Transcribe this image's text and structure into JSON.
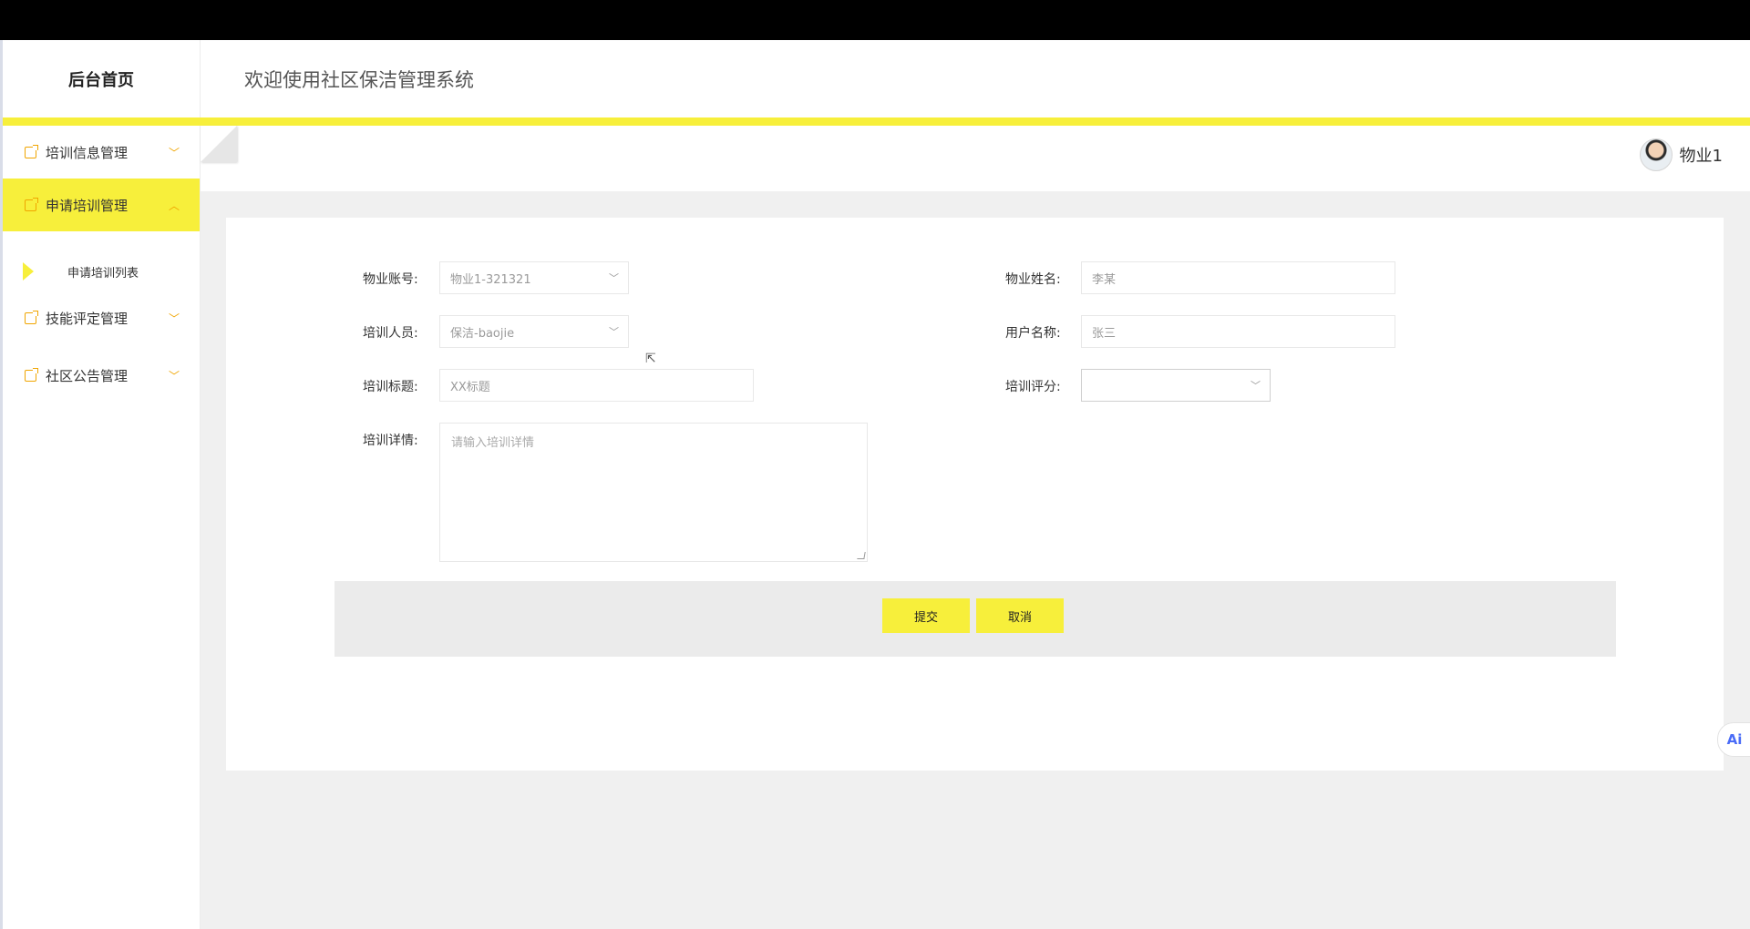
{
  "brand": {
    "title": "后台首页"
  },
  "header": {
    "welcome": "欢迎使用社区保洁管理系统"
  },
  "sidebar": {
    "items": [
      {
        "label": "培训信息管理",
        "icon": "folder-icon",
        "expanded": false
      },
      {
        "label": "申请培训管理",
        "icon": "folder-icon",
        "expanded": true
      },
      {
        "label": "技能评定管理",
        "icon": "folder-icon",
        "expanded": false
      },
      {
        "label": "社区公告管理",
        "icon": "folder-icon",
        "expanded": false
      }
    ],
    "sub_item": {
      "label": "申请培训列表"
    }
  },
  "user": {
    "name": "物业1",
    "avatar": "avatar-icon"
  },
  "form": {
    "account": {
      "label": "物业账号:",
      "value": "物业1-321321"
    },
    "owner_name": {
      "label": "物业姓名:",
      "value": "李某"
    },
    "trainee": {
      "label": "培训人员:",
      "value": "保洁-baojie"
    },
    "username": {
      "label": "用户名称:",
      "value": "张三"
    },
    "title": {
      "label": "培训标题:",
      "value": "XX标题"
    },
    "score": {
      "label": "培训评分:",
      "value": ""
    },
    "details": {
      "label": "培训详情:",
      "placeholder": "请输入培训详情"
    }
  },
  "buttons": {
    "submit": "提交",
    "cancel": "取消"
  },
  "ai_badge": {
    "label": "Ai"
  },
  "colors": {
    "accent": "#f7ef3b",
    "icon": "#f0a500",
    "topbar": "#000000"
  }
}
